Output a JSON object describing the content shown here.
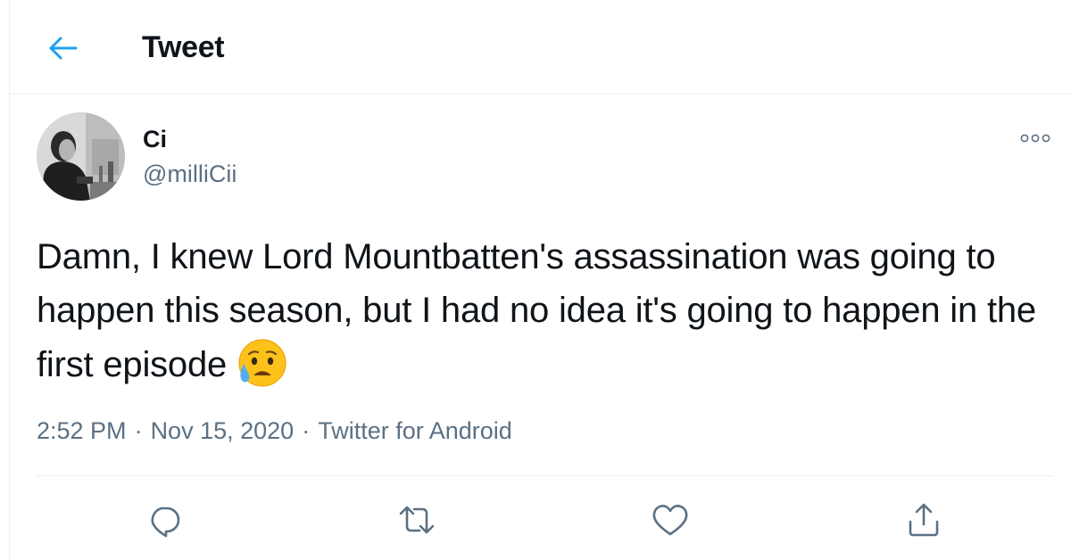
{
  "header": {
    "back_icon": "arrow-left-icon",
    "title": "Tweet"
  },
  "colors": {
    "accent": "#1da1f2",
    "text": "#0f1419",
    "secondary": "#5b7083",
    "divider": "#ebeef0"
  },
  "tweet": {
    "author_name": "Ci",
    "author_handle": "@milliCii",
    "text": "Damn, I knew Lord Mountbatten's assassination was going to happen this season, but I had no idea it's going to happen in the first episode",
    "emoji": "sad-but-relieved-face-emoji",
    "time": "2:52 PM",
    "date": "Nov 15, 2020",
    "source": "Twitter for Android",
    "separator": "·",
    "more_icon": "more-options-icon"
  },
  "actions": [
    {
      "icon": "reply-icon"
    },
    {
      "icon": "retweet-icon"
    },
    {
      "icon": "like-icon"
    },
    {
      "icon": "share-icon"
    }
  ]
}
